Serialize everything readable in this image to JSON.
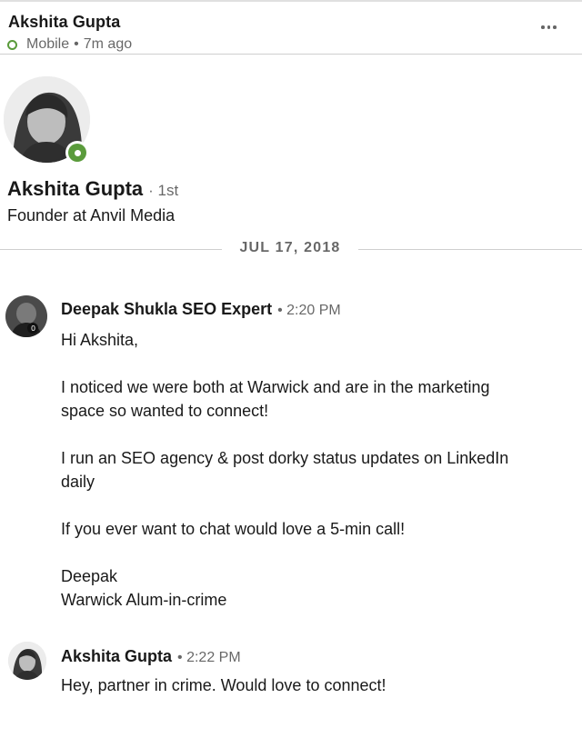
{
  "header": {
    "name": "Akshita Gupta",
    "device": "Mobile",
    "separator": "•",
    "last_active": "7m ago",
    "more_icon": "more-horizontal-icon"
  },
  "profile": {
    "name": "Akshita Gupta",
    "degree": "· 1st",
    "headline": "Founder at Anvil Media",
    "presence_color": "#5a9b3b"
  },
  "date_divider": "JUL 17, 2018",
  "messages": [
    {
      "sender": "Deepak Shukla SEO Expert",
      "time": "• 2:20 PM",
      "lines": [
        "Hi Akshita,",
        "I noticed we were both at Warwick and are in the marketing",
        "space so wanted to connect!",
        "I run an SEO agency & post dorky status updates on LinkedIn",
        "daily",
        "If you ever want to chat would love a 5-min call!",
        "Deepak",
        "Warwick Alum-in-crime"
      ]
    },
    {
      "sender": "Akshita Gupta",
      "time": "• 2:22 PM",
      "lines": [
        "Hey, partner in crime. Would love to connect!"
      ]
    }
  ]
}
